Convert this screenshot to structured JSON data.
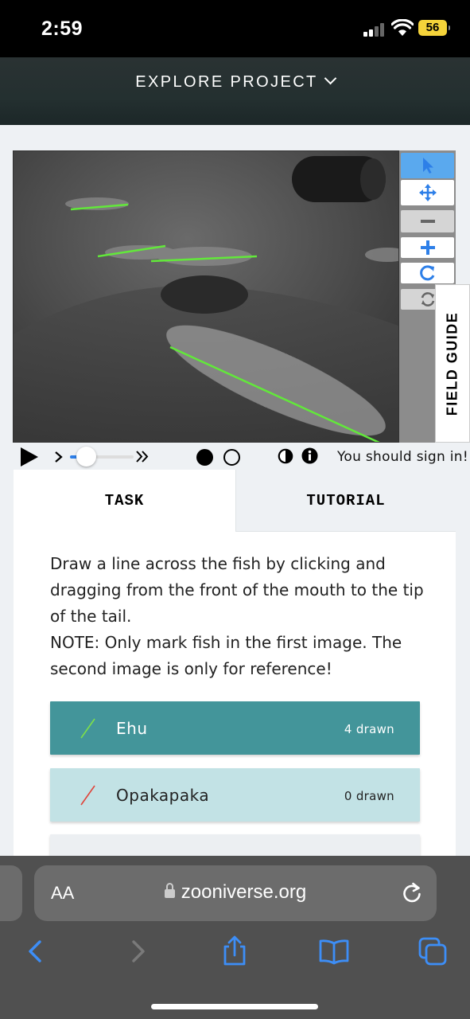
{
  "status_bar": {
    "time": "2:59",
    "battery": "56"
  },
  "header": {
    "title": "EXPLORE PROJECT"
  },
  "viewer": {
    "field_guide_label": "FIELD GUIDE",
    "signin_notice": "You should sign in!"
  },
  "tabs": {
    "task": "TASK",
    "tutorial": "TUTORIAL"
  },
  "task": {
    "instructions_line1": "Draw a line across the fish by clicking and dragging from the front of the mouth to the tip of the tail.",
    "instructions_line2": "NOTE: Only mark fish in the first image. The second image is only for reference!",
    "choices": [
      {
        "name": "Ehu",
        "count": "4 drawn",
        "color": "#7ee04a"
      },
      {
        "name": "Opakapaka",
        "count": "0 drawn",
        "color": "#e0443a"
      }
    ]
  },
  "browser": {
    "aa_label": "AA",
    "url": "zooniverse.org"
  },
  "colors": {
    "accent": "#43959a",
    "active_tool": "#5aa9ee",
    "icon_blue": "#2d7fe8",
    "line_green": "#62e83a"
  }
}
